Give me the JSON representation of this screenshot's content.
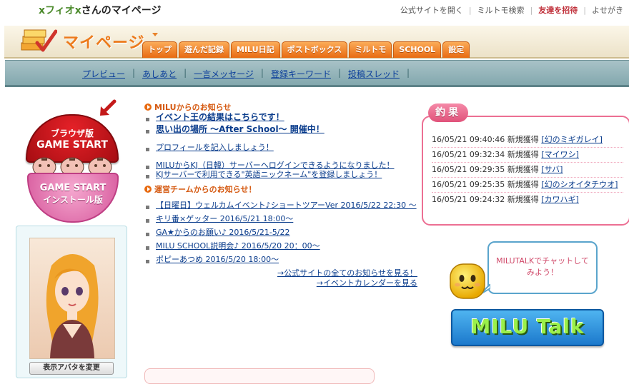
{
  "topbar": {
    "user_name": "xフィオx",
    "user_suffix": "さんのマイページ",
    "links": [
      {
        "label": "公式サイトを開く"
      },
      {
        "label": "ミルトモ検索"
      },
      {
        "label": "友達を招待"
      },
      {
        "label": "よせがき"
      }
    ]
  },
  "header": {
    "title": "マイページ",
    "tabs": [
      "トップ",
      "遊んだ記録",
      "MILU日記",
      "ポストボックス",
      "ミルトモ",
      "SCHOOL",
      "設定"
    ]
  },
  "subnav": {
    "links": [
      "プレビュー",
      "あしあと",
      "一言メッセージ",
      "登録キーワード",
      "投稿スレッド"
    ]
  },
  "game_start": {
    "browser_line1": "ブラウザ版",
    "browser_line2": "GAME START",
    "install_line1": "GAME START",
    "install_line2": "インストール版"
  },
  "avatar": {
    "change_label": "表示アバタを変更"
  },
  "news": {
    "milu_heading": "MILUからのお知らせ",
    "milu_items": [
      "イベント王の結果はこちらです！",
      "思い出の場所 ～After School～ 開催中！",
      "プロフィールを記入しましょう！",
      "MILUからKJ（日韓）サーバーへログインできるようになりました！",
      "KJサーバーで利用できる\"英語ニックネーム\"を登録しましょう！"
    ],
    "ops_heading": "運営チームからのお知らせ！",
    "ops_items": [
      "【日曜日】ウェルカムイベント♪ショートツアーVer 2016/5/22 22:30 ～",
      "キリ番×ゲッター 2016/5/21 18:00～",
      "GA★からのお願い♪ 2016/5/21-5/22",
      "MILU SCHOOL説明会♪ 2016/5/20 20：00～",
      "ポピーあつめ 2016/5/20 18:00～"
    ],
    "see_all": "→公式サイトの全てのお知らせを見る！",
    "see_calendar": "→イベントカレンダーを見る"
  },
  "fishing": {
    "title": "釣果",
    "items": [
      {
        "time": "16/05/21 09:40:46",
        "action": "新規獲得",
        "name": "[幻のミギガレイ]"
      },
      {
        "time": "16/05/21 09:32:34",
        "action": "新規獲得",
        "name": "[マイワシ]"
      },
      {
        "time": "16/05/21 09:29:35",
        "action": "新規獲得",
        "name": "[サバ]"
      },
      {
        "time": "16/05/21 09:25:35",
        "action": "新規獲得",
        "name": "[幻のシオイタチウオ]"
      },
      {
        "time": "16/05/21 09:24:32",
        "action": "新規獲得",
        "name": "[カワハギ]"
      }
    ]
  },
  "talk": {
    "bubble_text": "MILUTALKでチャットしてみよう！",
    "button_label": "MILU Talk"
  },
  "colors": {
    "accent_orange": "#e86b12",
    "subnav_teal": "#83a8ae",
    "fishing_pink": "#ec6f93",
    "link_blue": "#0a3c8c"
  }
}
